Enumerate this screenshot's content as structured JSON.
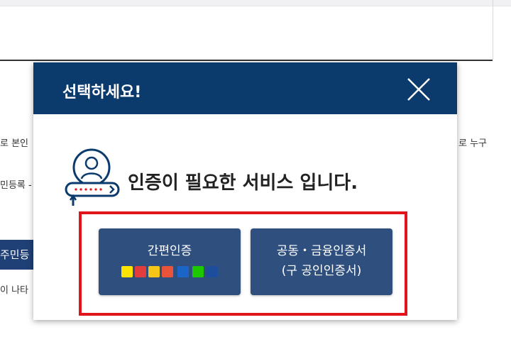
{
  "background": {
    "left_fragments": [
      "로 본인",
      "민등록 -",
      "주민등",
      "이 나타"
    ],
    "right_fragment": "로 누구"
  },
  "modal": {
    "title": "선택하세요!",
    "headline": "인증이 필요한 서비스 입니다.",
    "simple_auth": {
      "label": "간편인증",
      "providers": [
        {
          "name": "kakao",
          "color": "#fee500"
        },
        {
          "name": "pass",
          "color": "#e23c3c"
        },
        {
          "name": "payco",
          "color": "#f5c518"
        },
        {
          "name": "toss",
          "color": "#e9533a"
        },
        {
          "name": "samsung-pass",
          "color": "#1b64c8"
        },
        {
          "name": "naver",
          "color": "#1ec800"
        },
        {
          "name": "bank",
          "color": "#1d4e9e"
        }
      ]
    },
    "certificate_auth": {
      "label_line1": "공동・금융인증서",
      "label_line2": "(구 공인인증서)"
    }
  },
  "colors": {
    "header": "#0b3a6d",
    "button": "#2f4f7f",
    "highlight": "#e1141c"
  }
}
